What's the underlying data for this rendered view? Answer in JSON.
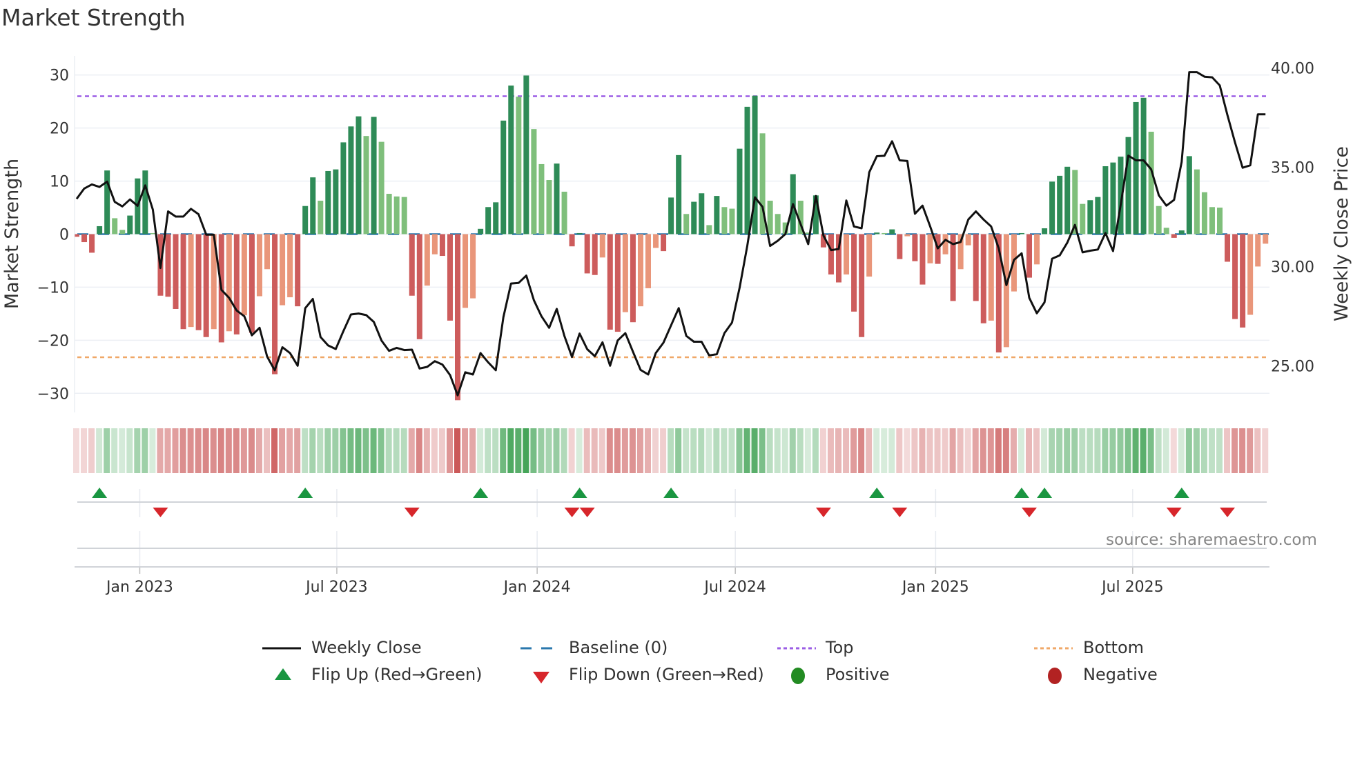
{
  "title": "Market Strength",
  "source": "source: sharemaestro.com",
  "legend": {
    "weekly_close": "Weekly Close",
    "baseline": "Baseline (0)",
    "top": "Top",
    "bottom": "Bottom",
    "flip_up": "Flip Up (Red→Green)",
    "flip_down": "Flip Down (Green→Red)",
    "positive": "Positive",
    "negative": "Negative"
  },
  "colors": {
    "pos_strong": "#2e8b57",
    "pos_weak": "#7fbf7b",
    "neg_strong": "#cd5c5c",
    "neg_weak": "#e9967a",
    "close": "#111111",
    "baseline": "#2a77ad",
    "top": "#9b5de5",
    "bottom": "#f0a868",
    "flip_up": "#1a9641",
    "flip_down": "#d7262b",
    "positive": "#228b22",
    "negative": "#b22222"
  },
  "chart_data": {
    "type": "bar+line",
    "title": "Market Strength",
    "ylabel": "Market Strength",
    "y2label": "Weekly Close Price",
    "ylim": [
      -33.6,
      33.6
    ],
    "y2lim": [
      22.65,
      40.6
    ],
    "yticks": [
      {
        "v": 30,
        "label": "30"
      },
      {
        "v": 20,
        "label": "20"
      },
      {
        "v": 10,
        "label": "10"
      },
      {
        "v": 0,
        "label": "0"
      },
      {
        "v": -10,
        "label": "−10"
      },
      {
        "v": -20,
        "label": "−20"
      },
      {
        "v": -30,
        "label": "−30"
      }
    ],
    "y2ticks": [
      {
        "v": 40,
        "label": "40.00"
      },
      {
        "v": 35,
        "label": "35.00"
      },
      {
        "v": 30,
        "label": "30.00"
      },
      {
        "v": 25,
        "label": "25.00"
      }
    ],
    "xticks": [
      {
        "label": "Jan 2023",
        "date": "2023-01-01"
      },
      {
        "label": "Jul 2023",
        "date": "2023-07-01"
      },
      {
        "label": "Jan 2024",
        "date": "2024-01-01"
      },
      {
        "label": "Jul 2024",
        "date": "2024-07-01"
      },
      {
        "label": "Jan 2025",
        "date": "2025-01-01"
      },
      {
        "label": "Jul 2025",
        "date": "2025-07-01"
      }
    ],
    "start_date": "2022-11-04",
    "frequency": "weekly",
    "top_level": 26,
    "bottom_level": -23.2,
    "strength": [
      -0.5,
      -1.5,
      -3.5,
      1.5,
      12,
      3,
      0.8,
      3.5,
      10.5,
      12,
      0.2,
      -11.6,
      -11.8,
      -14.1,
      -17.9,
      -17.5,
      -18.1,
      -19.4,
      -17.9,
      -20.4,
      -18.3,
      -18.9,
      -15.3,
      -18.6,
      -11.7,
      -6.6,
      -26.4,
      -13.4,
      -11.9,
      -13.6,
      5.3,
      10.7,
      6.3,
      11.9,
      12.2,
      17.3,
      20.3,
      22.2,
      18.5,
      22.1,
      17.4,
      7.6,
      7.1,
      7.0,
      -11.6,
      -19.8,
      -9.7,
      -3.8,
      -4.1,
      -16.3,
      -31.3,
      -13.9,
      -12.1,
      1.0,
      5.1,
      6.0,
      21.4,
      28.0,
      25.9,
      29.9,
      19.8,
      13.2,
      10.2,
      13.3,
      8.0,
      -2.3,
      0.2,
      -7.4,
      -7.7,
      -4.4,
      -18.0,
      -18.4,
      -14.7,
      -16.6,
      -13.6,
      -10.2,
      -2.6,
      -3.2,
      6.9,
      14.9,
      3.8,
      6.1,
      7.7,
      1.7,
      7.2,
      5.1,
      4.8,
      16.1,
      24.0,
      26.1,
      19.0,
      6.3,
      3.8,
      2.2,
      11.3,
      6.3,
      0.3,
      7.3,
      -2.5,
      -7.6,
      -9.1,
      -7.6,
      -14.6,
      -19.4,
      -8.0,
      0.3,
      0.2,
      0.9,
      -4.7,
      -0.4,
      -5.1,
      -9.5,
      -5.5,
      -5.6,
      -3.8,
      -12.6,
      -6.6,
      -2.1,
      -12.6,
      -16.8,
      -16.3,
      -22.3,
      -21.3,
      -10.8,
      0.2,
      -8.2,
      -5.7,
      1.1,
      9.9,
      11.0,
      12.7,
      12.1,
      5.7,
      6.4,
      7.0,
      12.8,
      13.5,
      14.6,
      18.3,
      24.9,
      25.7,
      19.3,
      5.3,
      1.2,
      -0.7,
      0.7,
      14.7,
      12.2,
      7.9,
      5.1,
      5.0,
      -5.2,
      -16.0,
      -17.6,
      -15.2,
      -6.1,
      -1.8
    ],
    "weekly_close": [
      33.4,
      33.92,
      34.13,
      34.0,
      34.27,
      33.25,
      33.02,
      33.37,
      33.05,
      34.08,
      32.86,
      29.92,
      32.77,
      32.51,
      32.51,
      32.9,
      32.63,
      31.6,
      31.6,
      28.82,
      28.42,
      27.78,
      27.49,
      26.53,
      26.91,
      25.46,
      24.77,
      25.93,
      25.64,
      25.0,
      27.9,
      28.36,
      26.45,
      26.02,
      25.84,
      26.74,
      27.58,
      27.63,
      27.55,
      27.2,
      26.27,
      25.75,
      25.9,
      25.79,
      25.81,
      24.86,
      24.94,
      25.23,
      25.06,
      24.53,
      23.51,
      24.67,
      24.56,
      25.64,
      25.17,
      24.77,
      27.44,
      29.14,
      29.17,
      29.54,
      28.3,
      27.49,
      26.91,
      27.86,
      26.5,
      25.44,
      26.62,
      25.83,
      25.48,
      26.18,
      25.0,
      26.27,
      26.64,
      25.71,
      24.79,
      24.56,
      25.64,
      26.16,
      27.03,
      27.9,
      26.5,
      26.21,
      26.21,
      25.52,
      25.58,
      26.64,
      27.17,
      28.94,
      31.03,
      33.48,
      33.0,
      31.03,
      31.29,
      31.63,
      33.14,
      32.13,
      31.12,
      33.55,
      31.55,
      30.82,
      30.88,
      33.32,
      32.01,
      31.92,
      34.74,
      35.55,
      35.57,
      36.3,
      35.34,
      35.31,
      32.65,
      33.06,
      32.01,
      30.91,
      31.34,
      31.12,
      31.23,
      32.36,
      32.77,
      32.36,
      32.01,
      30.91,
      29.06,
      30.33,
      30.66,
      28.42,
      27.64,
      28.19,
      30.39,
      30.56,
      31.2,
      32.09,
      30.71,
      30.79,
      30.85,
      31.68,
      30.77,
      33.11,
      35.58,
      35.34,
      35.34,
      34.89,
      33.58,
      33.06,
      33.35,
      35.26,
      39.78,
      39.78,
      39.55,
      39.52,
      39.11,
      37.63,
      36.24,
      34.97,
      35.09,
      37.66,
      37.66
    ],
    "flip_up_weeks": [
      3,
      30,
      53,
      66,
      78,
      105,
      124,
      127,
      145
    ],
    "flip_down_weeks": [
      11,
      44,
      65,
      67,
      98,
      108,
      125,
      144,
      151
    ]
  }
}
